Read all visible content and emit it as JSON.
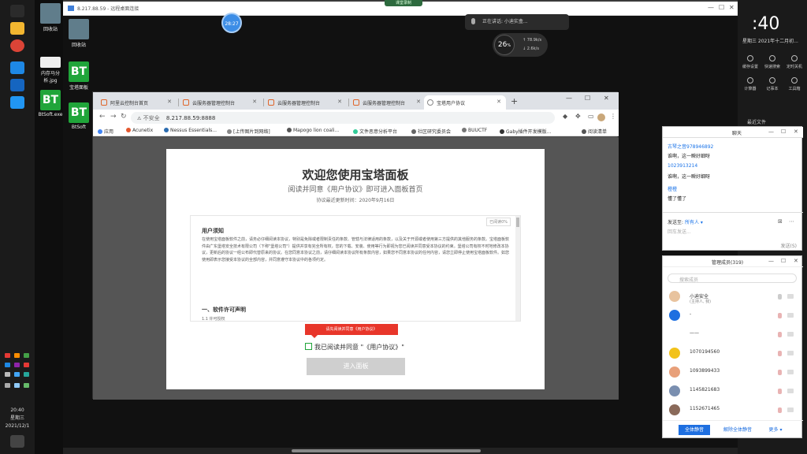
{
  "taskbar": {
    "clock_time": "20:40",
    "clock_day": "星期三",
    "clock_date": "2021/12/1"
  },
  "desktop": {
    "icons": [
      {
        "label": "回收站"
      },
      {
        "label": "内存马分析.jpg"
      },
      {
        "label": "BtSoft.exe",
        "glyph": "BT"
      },
      {
        "label": "回收站"
      },
      {
        "label": "宝塔面板",
        "glyph": "BT"
      },
      {
        "label": "BtSoft",
        "glyph": "BT"
      }
    ]
  },
  "remote": {
    "title": "8.217.88.59 - 远程桌面连接"
  },
  "widgets": {
    "timer": "28:27",
    "voice_text": "正在讲话: 小迪实盒...",
    "speed_value": "26",
    "speed_unit": "%",
    "speed_up": "78.9k/s",
    "speed_down": "2.6k/s",
    "green_tag": "课堂录制"
  },
  "chrome": {
    "tabs": [
      {
        "label": "阿里云控制台首页"
      },
      {
        "label": "云服务器管理控制台"
      },
      {
        "label": "云服务器管理控制台"
      },
      {
        "label": "云服务器管理控制台"
      },
      {
        "label": "宝塔用户协议",
        "active": true
      }
    ],
    "address_insecure": "不安全",
    "address_url": "8.217.88.59:8888",
    "bookmarks": [
      {
        "label": "应用",
        "color": "#4285f4"
      },
      {
        "label": "Acunetix",
        "color": "#e4572e"
      },
      {
        "label": "Nessus Essentials...",
        "color": "#2b6cb0"
      },
      {
        "label": "[上传图片到网络]",
        "color": "#888"
      },
      {
        "label": "Mapogo lion coali...",
        "color": "#555"
      },
      {
        "label": "文件恶意分析平台",
        "color": "#3c9"
      },
      {
        "label": "社区研究委员会",
        "color": "#666"
      },
      {
        "label": "BUUCTF",
        "color": "#777"
      },
      {
        "label": "Gaby插件开发模版...",
        "color": "#333"
      },
      {
        "label": "阅读清单",
        "color": "#555"
      }
    ]
  },
  "dialog": {
    "title": "欢迎您使用宝塔面板",
    "subtitle": "阅读并同意《用户协议》即可进入面板首页",
    "date": "协议最近更新时间：2020年9月16日",
    "read_pct": "已阅读0%",
    "agree_heading": "用户须知",
    "agree_text": "在使用宝塔面板软件之前，请务必仔细阅读本协议，特别是免除或者限制责任的条款、管辖与法律适用的条款，以及关于开源或者使用第三方提供的其他服务的条款。宝塔面板软件由广东堡塔安全技术有限公司（下称\"堡塔公司\"）提供并享有完全所有权，您的下载、安装、使用等行为即视为您已阅读并同意受本协议的约束。堡塔公司有权不时地修改本协议，更新后的协议一经公布即代替原来的协议。在您同意本协议之前，请仔细阅读本协议所有条款内容，如果您不同意本协议的任何内容，请您立即停止使用宝塔面板软件。如您使用即表示您接受本协议的全部内容，并同意遵守本协议中的各项约定。",
    "agree_section": "一、软件许可声明",
    "agree_sub": "1.1 许可授权",
    "tip": "请先阅读并同意《用户协议》",
    "checkbox_label": "我已阅读并同意 \"《用户协议》\"",
    "enter_button": "进入面板"
  },
  "right_panel": {
    "clock": ":40",
    "date": "星期三 2021年十二月初...",
    "buttons": [
      {
        "label": "缓存设置"
      },
      {
        "label": "快速搜索"
      },
      {
        "label": "定时关机"
      },
      {
        "label": "计算器"
      },
      {
        "label": "记事本"
      },
      {
        "label": "工具箱"
      }
    ],
    "files_label": "最近文件"
  },
  "chat": {
    "title": "聊天",
    "messages": [
      {
        "name": "古琴之音978946892",
        "text": "谁啊，这一瞬好细呀"
      },
      {
        "name": "1023913214",
        "text": "谁啊，这一瞬好细呀"
      },
      {
        "name": "橙橙",
        "text": "懂了懂了"
      }
    ],
    "send_to_label": "发送至:",
    "send_to_value": "所有人 ▾",
    "input_placeholder": "回车发送...",
    "send_button": "发送(S)"
  },
  "members": {
    "title": "管理成员(319)",
    "search_placeholder": "搜索成员",
    "list": [
      {
        "name": "小迪安全",
        "role": "(主持人, 我)",
        "color": "#e8c39e"
      },
      {
        "name": "-",
        "role": "",
        "color": "#1e6fe0"
      },
      {
        "name": "——",
        "role": "",
        "color": "#ffffff"
      },
      {
        "name": "1070194560",
        "role": "",
        "color": "#f2c21a"
      },
      {
        "name": "1093899433",
        "role": "",
        "color": "#e8a07a"
      },
      {
        "name": "1145821683",
        "role": "",
        "color": "#7a8fb0"
      },
      {
        "name": "1152671465",
        "role": "",
        "color": "#8a6a5a"
      }
    ],
    "mute_all": "全体静音",
    "unmute_all": "解除全体静音",
    "more": "更多 ▾"
  }
}
